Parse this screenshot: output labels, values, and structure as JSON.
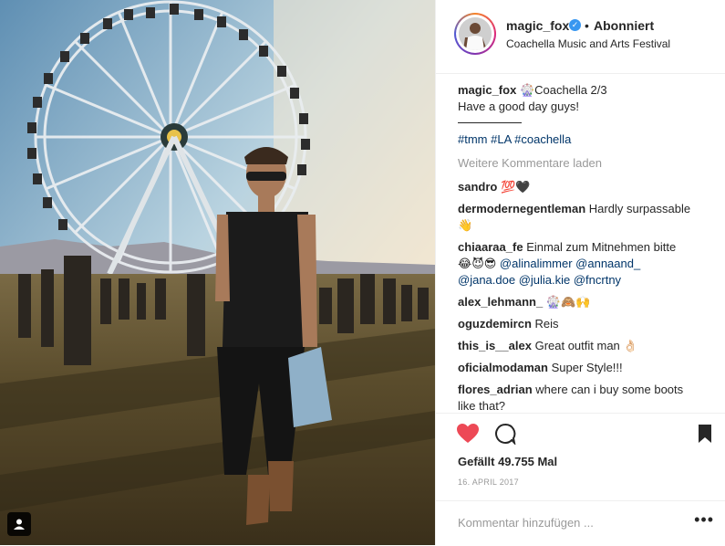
{
  "header": {
    "username": "magic_fox",
    "separator": "•",
    "follow_status": "Abonniert",
    "location": "Coachella Music and Arts Festival"
  },
  "caption": {
    "username": "magic_fox",
    "text": "Coachella 2/3",
    "line2": "Have a good day guys!",
    "hashtags": "#tmm #LA #coachella"
  },
  "load_more": "Weitere Kommentare laden",
  "comments": [
    {
      "user": "sandro",
      "text": "💯🖤"
    },
    {
      "user": "dermodernegentleman",
      "text": "Hardly surpassable",
      "line2": "👋"
    },
    {
      "user": "chiaaraa_fe",
      "text": "Einmal zum Mitnehmen bitte",
      "line2_mentions": "@alinalimmer @annaand_",
      "line3_mentions": "@jana.doe @julia.kie @fncrtny"
    },
    {
      "user": "alex_lehmann_",
      "text": "🎡🙈🙌"
    },
    {
      "user": "oguzdemircn",
      "text": "Reis"
    },
    {
      "user": "this_is__alex",
      "text": "Great outfit man 👌🏻"
    },
    {
      "user": "oficialmodaman",
      "text": "Super Style!!!"
    },
    {
      "user": "flores_adrian",
      "text": "where can i buy some boots",
      "line2": "like that?"
    }
  ],
  "likes": "Gefällt 49.755 Mal",
  "date": "16. APRIL 2017",
  "add_comment_placeholder": "Kommentar hinzufügen ...",
  "more_options": "•••",
  "colors": {
    "like": "#ed4956",
    "link": "#003569",
    "muted": "#999999",
    "verified": "#3897f0"
  }
}
